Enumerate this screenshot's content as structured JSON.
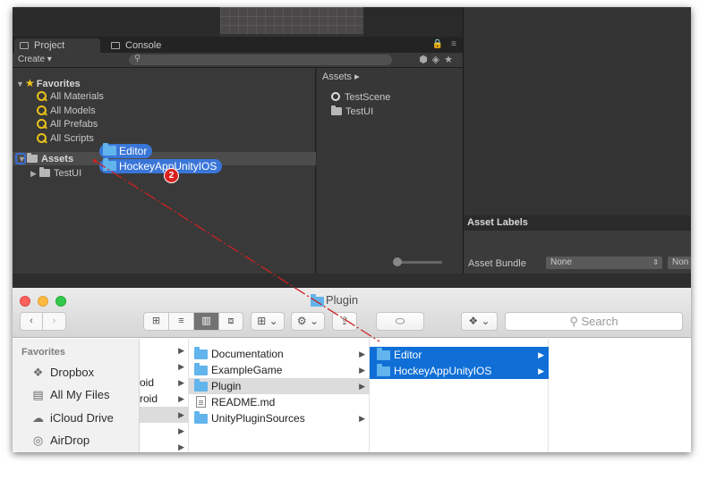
{
  "unity": {
    "tabs": {
      "project": "Project",
      "console": "Console"
    },
    "toolbar": {
      "create": "Create ▾"
    },
    "favorites": {
      "label": "Favorites",
      "items": [
        "All Materials",
        "All Models",
        "All Prefabs",
        "All Scripts"
      ]
    },
    "assets_tree": {
      "label": "Assets",
      "children": [
        "TestUI"
      ]
    },
    "dragged_items": [
      "Editor",
      "HockeyAppUnityIOS"
    ],
    "drag_count": "2",
    "assets_pane": {
      "breadcrumb": "Assets ▸",
      "items": [
        "TestScene",
        "TestUI"
      ]
    },
    "inspector": {
      "asset_labels": "Asset Labels",
      "asset_bundle_label": "Asset Bundle",
      "bundle_value": "None",
      "variant_value": "Non"
    }
  },
  "finder": {
    "title": "Plugin",
    "search_placeholder": "Search",
    "sidebar": {
      "heading": "Favorites",
      "items": [
        "Dropbox",
        "All My Files",
        "iCloud Drive",
        "AirDrop"
      ]
    },
    "col1_fragments": [
      "oid",
      "roid"
    ],
    "col2": [
      "Documentation",
      "ExampleGame",
      "Plugin",
      "README.md",
      "UnityPluginSources"
    ],
    "col3": [
      "Editor",
      "HockeyAppUnityIOS"
    ]
  },
  "colors": {
    "selection_blue": "#0f6fd6",
    "unity_selection": "#3a76d8",
    "drag_line": "#cc2222",
    "badge": "#d9221e"
  }
}
